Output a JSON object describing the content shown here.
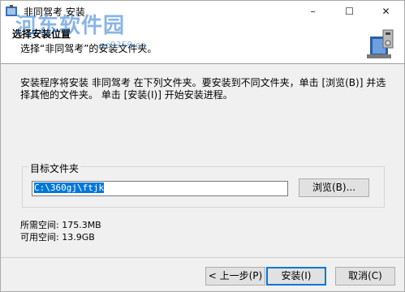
{
  "window": {
    "title": "非同驾考 安装",
    "app_icon": "installer-icon",
    "controls": {
      "minimize": "–",
      "maximize": "☐",
      "close": "✕"
    }
  },
  "header": {
    "title": "选择安装位置",
    "subtitle": "选择“非同驾考”的安装文件夹。",
    "icon": "install-package-icon"
  },
  "watermark": {
    "text": "河东软件园",
    "url": ".pc0359.cn"
  },
  "description": "安装程序将安装 非同驾考  在下列文件夹。要安装到不同文件夹，单击 [浏览(B)] 并选择其他的文件夹。 单击 [安装(I)] 开始安装进程。",
  "destination": {
    "group_label": "目标文件夹",
    "path": "C:\\360gj\\ftjk",
    "browse_label": "浏览(B)..."
  },
  "space": {
    "required": "所需空间: 175.3MB",
    "available": "可用空间: 13.9GB"
  },
  "buttons": {
    "back": "< 上一步(P)",
    "install": "安装(I)",
    "cancel": "取消(C)"
  },
  "colors": {
    "accent": "#0078d7",
    "watermark": "#2878d2"
  }
}
